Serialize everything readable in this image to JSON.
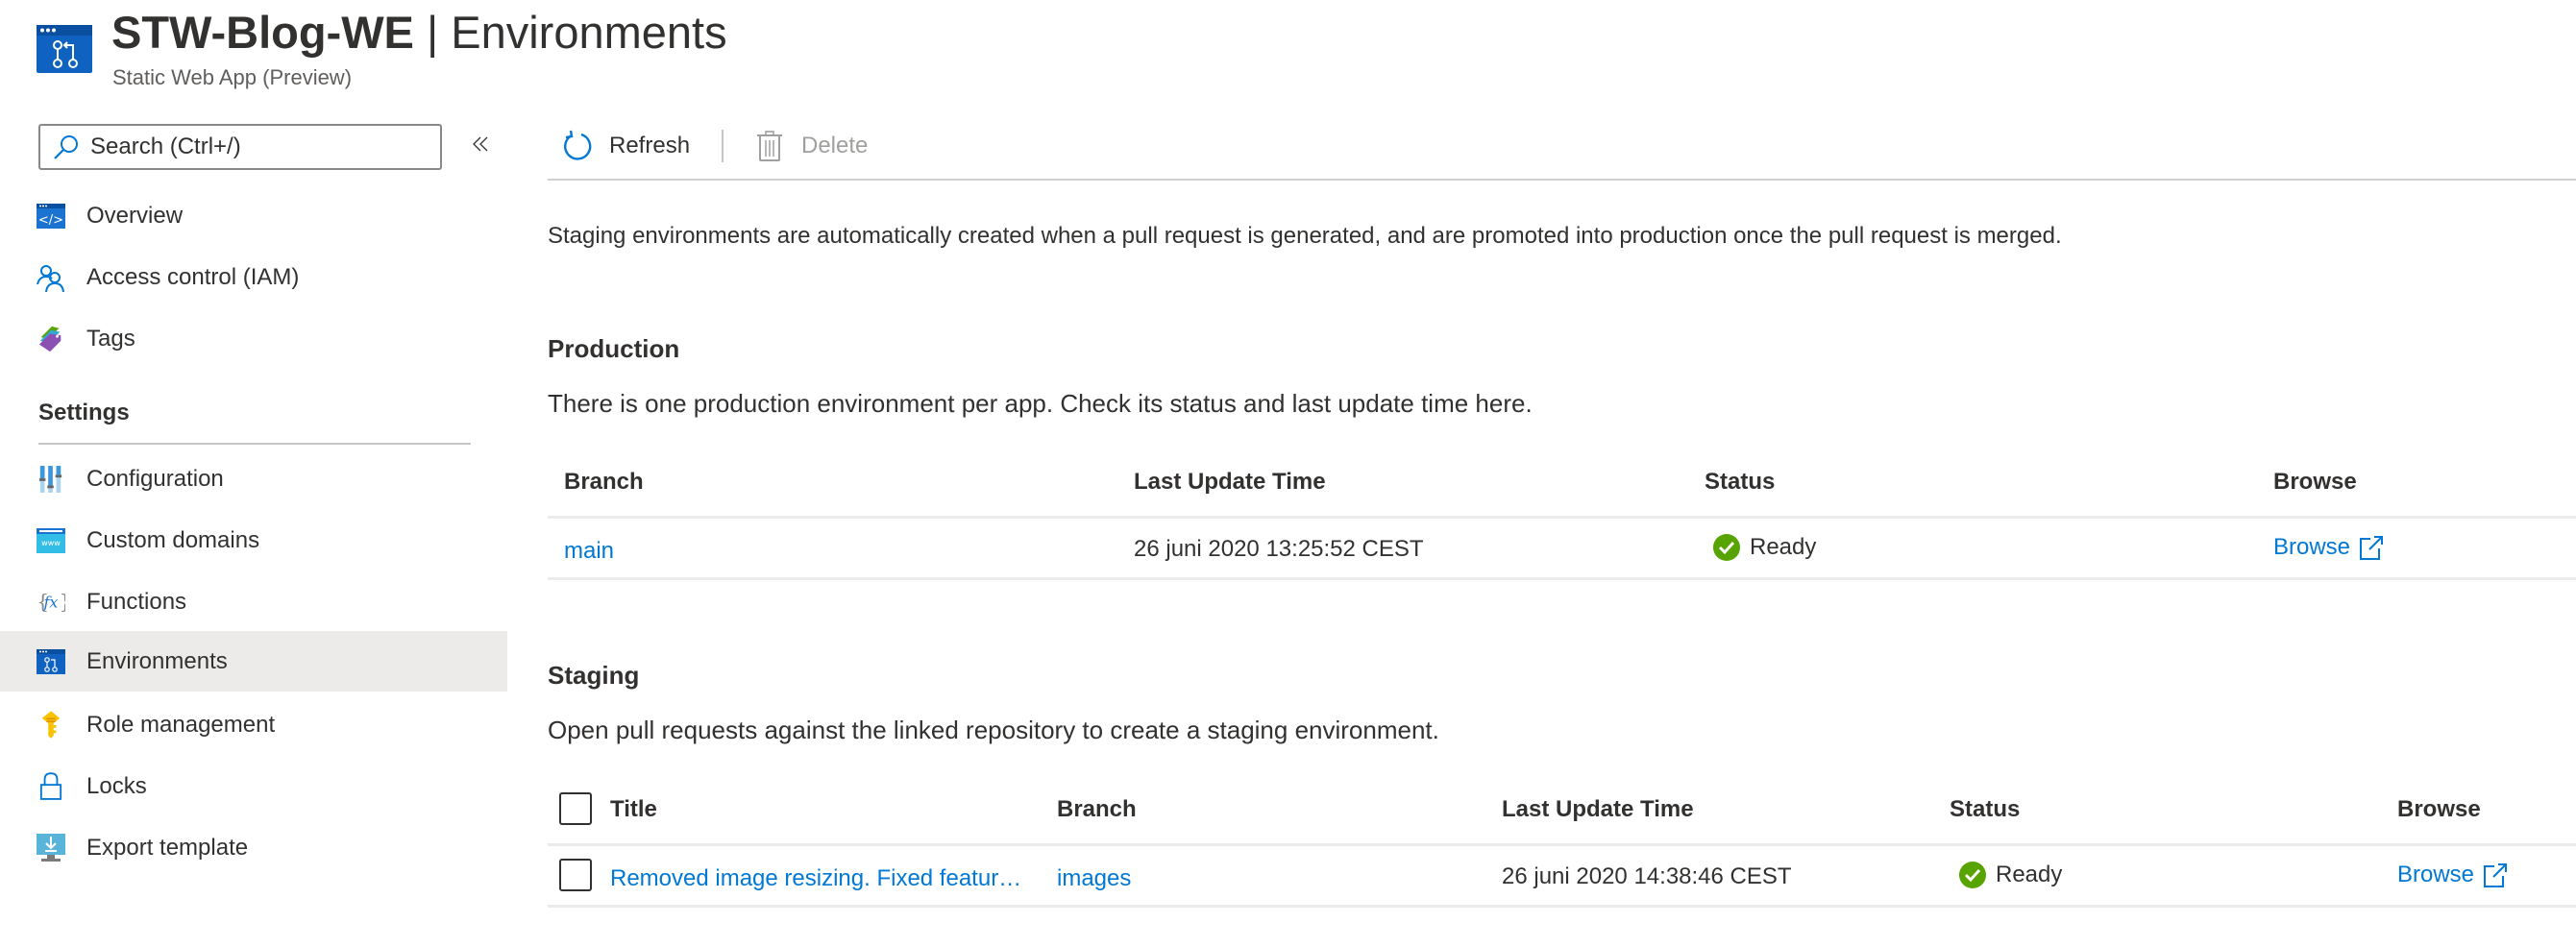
{
  "header": {
    "resource_name": "STW-Blog-WE",
    "separator": " | ",
    "page_name": "Environments",
    "subtitle": "Static Web App (Preview)",
    "icon": "static-web-app-environments-icon"
  },
  "sidebar": {
    "search_placeholder": "Search (Ctrl+/)",
    "collapse_label": "«",
    "items": [
      {
        "label": "Overview",
        "icon": "overview-icon"
      },
      {
        "label": "Access control (IAM)",
        "icon": "access-control-icon"
      },
      {
        "label": "Tags",
        "icon": "tags-icon"
      }
    ],
    "settings_heading": "Settings",
    "settings_items": [
      {
        "label": "Configuration",
        "icon": "configuration-icon"
      },
      {
        "label": "Custom domains",
        "icon": "custom-domains-icon"
      },
      {
        "label": "Functions",
        "icon": "functions-icon"
      },
      {
        "label": "Environments",
        "icon": "environments-icon",
        "active": true
      },
      {
        "label": "Role management",
        "icon": "key-icon"
      },
      {
        "label": "Locks",
        "icon": "lock-icon"
      },
      {
        "label": "Export template",
        "icon": "export-template-icon"
      }
    ]
  },
  "toolbar": {
    "refresh_label": "Refresh",
    "delete_label": "Delete"
  },
  "main": {
    "description": "Staging environments are automatically created when a pull request is generated, and are promoted into production once the pull request is merged.",
    "production": {
      "title": "Production",
      "description": "There is one production environment per app. Check its status and last update time here.",
      "columns": [
        "Branch",
        "Last Update Time",
        "Status",
        "Browse"
      ],
      "rows": [
        {
          "branch": "main",
          "last_update": "26 juni 2020 13:25:52 CEST",
          "status": "Ready",
          "browse": "Browse"
        }
      ]
    },
    "staging": {
      "title": "Staging",
      "description": "Open pull requests against the linked repository to create a staging environment.",
      "columns": [
        "Title",
        "Branch",
        "Last Update Time",
        "Status",
        "Browse"
      ],
      "rows": [
        {
          "title": "Removed image resizing. Fixed featur…",
          "branch": "images",
          "last_update": "26 juni 2020 14:38:46 CEST",
          "status": "Ready",
          "browse": "Browse"
        }
      ]
    }
  },
  "colors": {
    "accent": "#0078d4",
    "success": "#57a300",
    "active_bg": "#edebe9",
    "text": "#323130",
    "disabled": "#a19f9d"
  }
}
